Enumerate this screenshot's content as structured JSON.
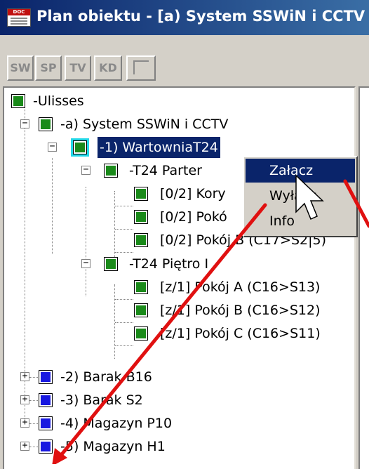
{
  "window": {
    "title": "Plan obiektu - [a) System SSWiN i CCTV",
    "icon_label": "DOC"
  },
  "toolbar": {
    "buttons": [
      {
        "label": "SW"
      },
      {
        "label": "SP"
      },
      {
        "label": "TV"
      },
      {
        "label": "KD"
      },
      {
        "label": "",
        "icon": "window-layout-icon"
      }
    ]
  },
  "tree": {
    "root": "-Ulisses",
    "system": "-a) System SSWiN i CCTV",
    "selected": "-1) WartowniaT24",
    "floor1": "-T24 Parter",
    "floor1_rooms": [
      "[0/2] Kory",
      "[0/2] Pokó",
      "[0/2] Pokój B (C17>S2|5)"
    ],
    "floor2": "-T24 Piętro I",
    "floor2_rooms": [
      "[z/1] Pokój A (C16>S13)",
      "[z/1] Pokój B (C16>S12)",
      "[z/1] Pokój C (C16>S11)"
    ],
    "others": [
      "-2) Barak B16",
      "-3) Barak S2",
      "-4) Magazyn P10",
      "-5) Magazyn H1"
    ]
  },
  "context_menu": {
    "items": [
      "Załącz",
      "Wyłącz",
      "Info"
    ],
    "highlighted_index": 0
  },
  "colors": {
    "node_green": "#1a8a1a",
    "node_blue": "#1818e0",
    "selection": "#0a246a",
    "annotation_arrow": "#e01010"
  }
}
